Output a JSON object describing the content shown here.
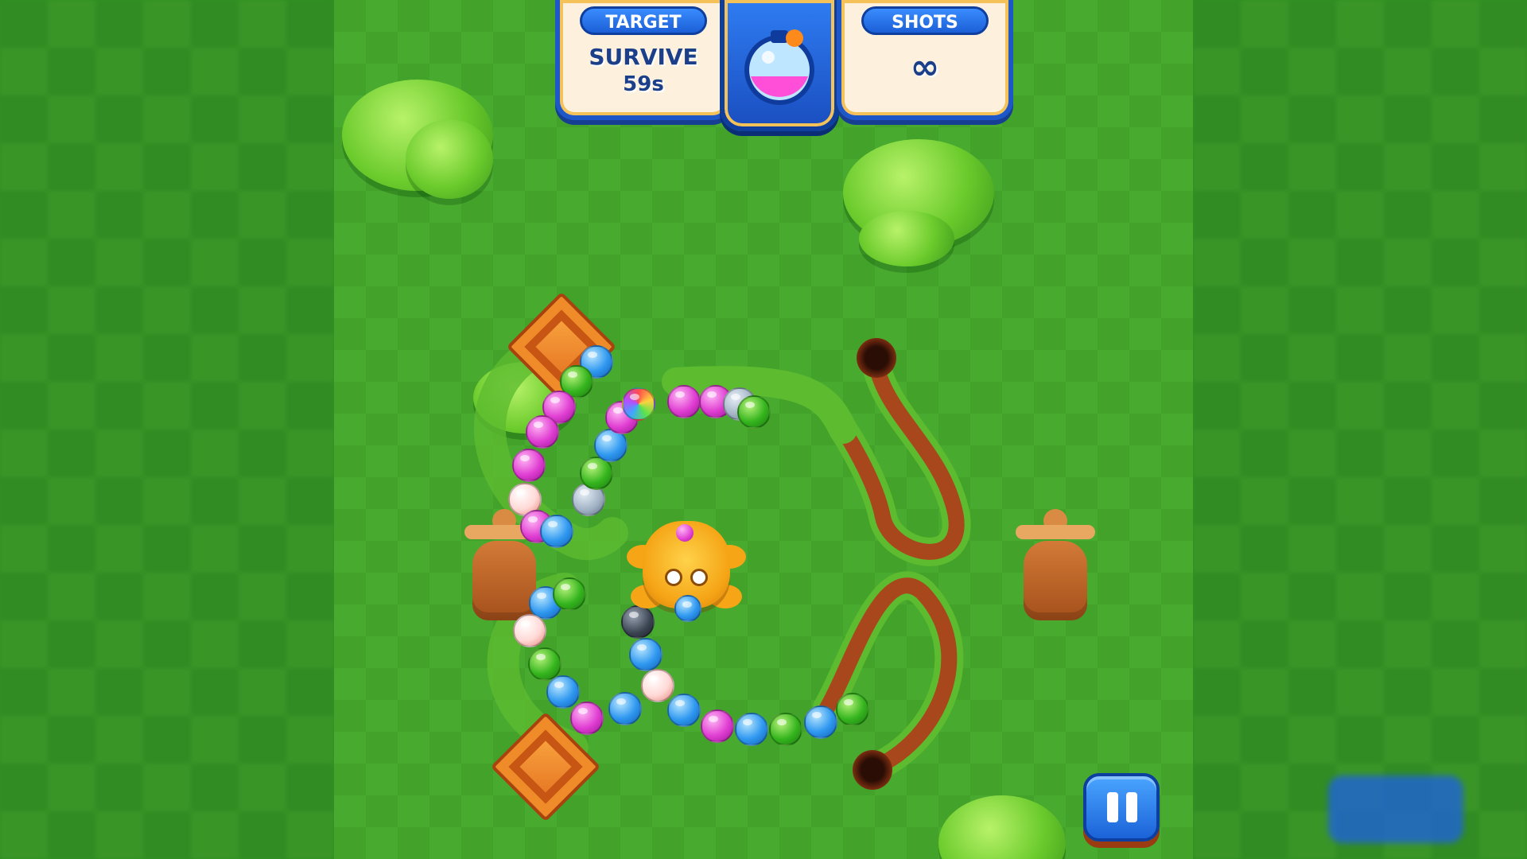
{
  "hud": {
    "target_label": "TARGET",
    "target_line1": "SURVIVE",
    "target_line2": "59s",
    "shots_label": "SHOTS",
    "shots_value": "∞"
  },
  "colors": {
    "ui_blue": "#1e58c8",
    "panel_cream": "#fdf1dd",
    "grass": "#49aa30",
    "path_brown": "#a9471c"
  },
  "icons": {
    "potion": "potion-flask-icon",
    "pause": "pause-icon"
  },
  "chains": {
    "top": [
      "blue",
      "green",
      "pink",
      "pink",
      "pink",
      "white",
      "pink",
      "blue",
      "grey",
      "green",
      "blue",
      "pink",
      "rainbow",
      "pink",
      "pink",
      "grey",
      "green"
    ],
    "bottom": [
      "blue",
      "green",
      "white",
      "green",
      "blue",
      "pink",
      "blue",
      "dark",
      "blue",
      "white",
      "blue",
      "pink",
      "blue",
      "green",
      "blue",
      "green"
    ]
  },
  "shooter_ammo": {
    "current": "pink",
    "next": "blue"
  }
}
